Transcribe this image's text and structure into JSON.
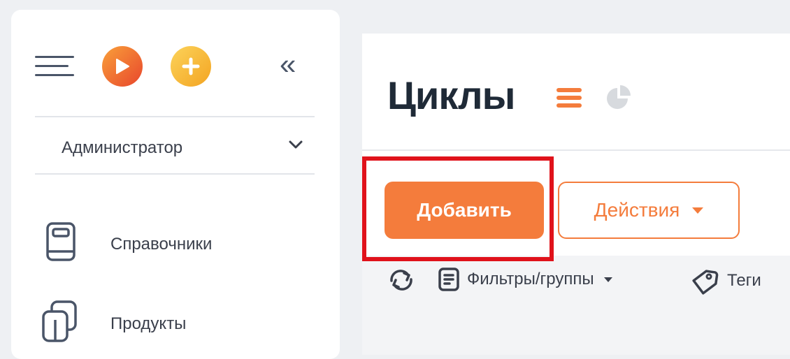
{
  "sidebar": {
    "role": "Администратор",
    "nav_items": [
      {
        "label": "Справочники",
        "icon": "book-icon"
      },
      {
        "label": "Продукты",
        "icon": "boxes-icon"
      }
    ]
  },
  "main": {
    "title": "Циклы",
    "add_button": "Добавить",
    "actions_button": "Действия",
    "toolbar": {
      "filters_label": "Фильтры/группы",
      "tags_label": "Теги"
    }
  },
  "colors": {
    "accent": "#f47c3c",
    "highlight": "#e0121b",
    "text": "#3a3f4b"
  }
}
